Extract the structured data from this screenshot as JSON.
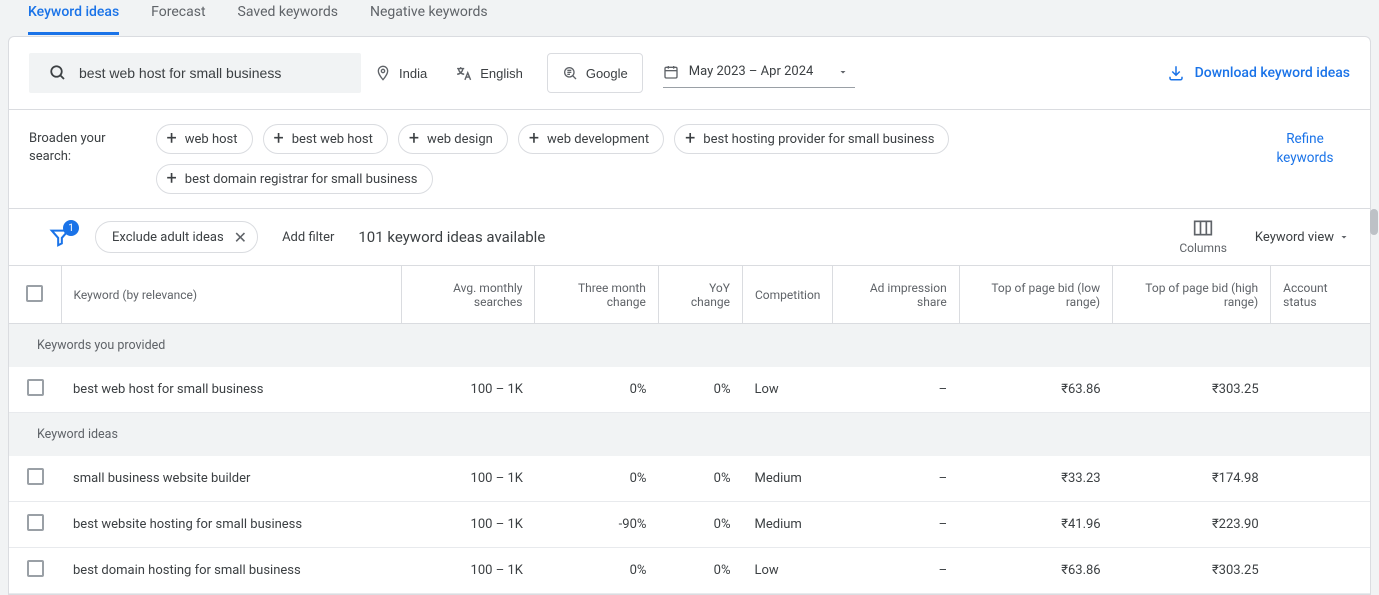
{
  "tabs": {
    "keyword_ideas": "Keyword ideas",
    "forecast": "Forecast",
    "saved_keywords": "Saved keywords",
    "negative_keywords": "Negative keywords"
  },
  "toolbar": {
    "search_value": "best web host for small business",
    "location": "India",
    "language": "English",
    "network": "Google",
    "date_range": "May 2023 – Apr 2024",
    "download": "Download keyword ideas"
  },
  "broaden": {
    "label_line1": "Broaden your",
    "label_line2": "search:",
    "chips": [
      "web host",
      "best web host",
      "web design",
      "web development",
      "best hosting provider for small business",
      "best domain registrar for small business"
    ],
    "refine_line1": "Refine",
    "refine_line2": "keywords"
  },
  "filters": {
    "badge": "1",
    "exclude_adult": "Exclude adult ideas",
    "add_filter": "Add filter",
    "ideas_count": "101 keyword ideas available",
    "columns_label": "Columns",
    "view_label": "Keyword view"
  },
  "columns": {
    "keyword": "Keyword (by relevance)",
    "avg": "Avg. monthly searches",
    "three_month": "Three month change",
    "yoy": "YoY change",
    "competition": "Competition",
    "ad_impression": "Ad impression share",
    "bid_low": "Top of page bid (low range)",
    "bid_high": "Top of page bid (high range)",
    "account_status": "Account status"
  },
  "sections": {
    "provided": "Keywords you provided",
    "ideas": "Keyword ideas"
  },
  "rows": {
    "r0": {
      "keyword": "best web host for small business",
      "avg": "100 – 1K",
      "tmc": "0%",
      "yoy": "0%",
      "comp": "Low",
      "imp": "–",
      "low": "₹63.86",
      "high": "₹303.25",
      "status": ""
    },
    "r1": {
      "keyword": "small business website builder",
      "avg": "100 – 1K",
      "tmc": "0%",
      "yoy": "0%",
      "comp": "Medium",
      "imp": "–",
      "low": "₹33.23",
      "high": "₹174.98",
      "status": ""
    },
    "r2": {
      "keyword": "best website hosting for small business",
      "avg": "100 – 1K",
      "tmc": "-90%",
      "yoy": "0%",
      "comp": "Medium",
      "imp": "–",
      "low": "₹41.96",
      "high": "₹223.90",
      "status": ""
    },
    "r3": {
      "keyword": "best domain hosting for small business",
      "avg": "100 – 1K",
      "tmc": "0%",
      "yoy": "0%",
      "comp": "Low",
      "imp": "–",
      "low": "₹63.86",
      "high": "₹303.25",
      "status": ""
    }
  }
}
